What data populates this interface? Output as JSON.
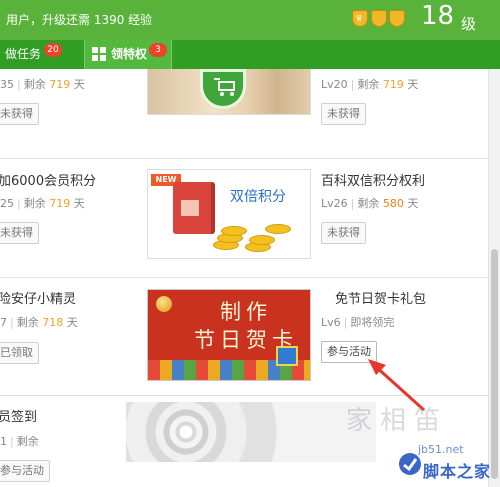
{
  "header": {
    "status_text": "用户，升级还需 1390 经验",
    "level_number": "18",
    "level_unit": "级"
  },
  "tabs": [
    {
      "label": "做任务",
      "count": "20"
    },
    {
      "label": "领特权",
      "count": "3"
    }
  ],
  "privileges": [
    {
      "title": "",
      "level": "35",
      "remaining_label": "剩余",
      "days": "719",
      "days_unit": "天",
      "button": "未获得",
      "right_level": "Lv20",
      "right_days": "719",
      "right_button": "未获得"
    },
    {
      "title": "加6000会员积分",
      "level": "25",
      "remaining_label": "剩余",
      "days": "719",
      "days_unit": "天",
      "button": "未获得",
      "image_text": "双倍积分",
      "new_tag": "NEW",
      "right_title": "百科双信积分权利",
      "right_level": "Lv26",
      "right_days": "580",
      "right_button": "未获得"
    },
    {
      "title": "险安仔小精灵",
      "level": "7",
      "remaining_label": "剩余",
      "days": "718",
      "days_unit": "天",
      "button": "已领取",
      "image_line1": "制作",
      "image_line2": "节日贺卡",
      "right_title": "免节日贺卡礼包",
      "right_level": "Lv6",
      "right_status": "即将领完",
      "right_button": "参与活动"
    },
    {
      "title": "员签到",
      "level": "1",
      "remaining_label": "剩余",
      "button": "参与活动"
    }
  ],
  "watermark": {
    "site": "jb51.net",
    "name": "脚本之家"
  },
  "colors": {
    "header_bg": "#59b23a",
    "tabbar_bg": "#2f9e23",
    "active_tab_bg": "#52b83e",
    "count_badge": "#e8452c",
    "days_highlight": "#f0a030",
    "arrow": "#e8352b"
  }
}
